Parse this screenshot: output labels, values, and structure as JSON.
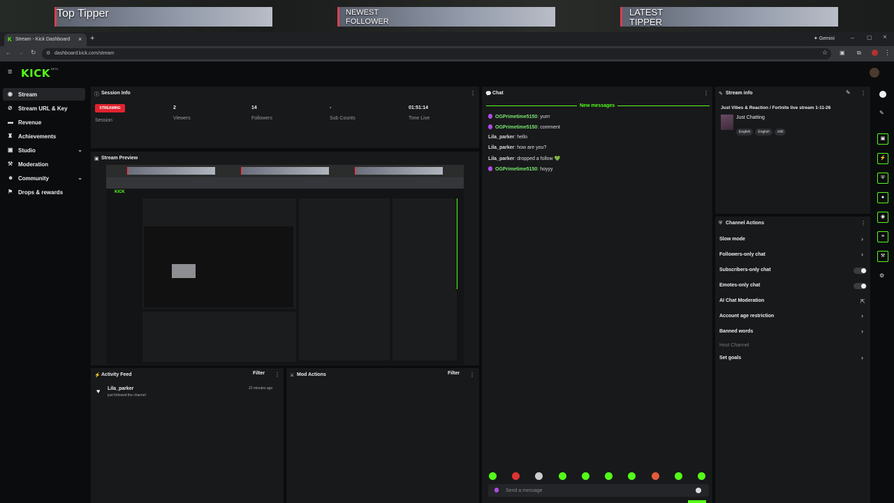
{
  "overlay": {
    "top_tipper": "Top Tipper",
    "newest_follower_l1": "NEWEST",
    "newest_follower_l2": "FOLLOWER",
    "latest_tipper_l1": "LATEST",
    "latest_tipper_l2": "TIPPER"
  },
  "browser": {
    "tab_title": "Stream - Kick Dashboard",
    "url": "dashboard.kick.com/stream",
    "gemini": "Gemini"
  },
  "app": {
    "logo": "KICK",
    "logo_tag": "BETA"
  },
  "sidebar": {
    "items": [
      {
        "label": "Stream",
        "icon": "broadcast-icon"
      },
      {
        "label": "Stream URL & Key",
        "icon": "link-icon"
      },
      {
        "label": "Revenue",
        "icon": "revenue-icon"
      },
      {
        "label": "Achievements",
        "icon": "trophy-icon"
      },
      {
        "label": "Studio",
        "icon": "studio-icon"
      },
      {
        "label": "Moderation",
        "icon": "wrench-icon"
      },
      {
        "label": "Community",
        "icon": "community-icon"
      },
      {
        "label": "Drops & rewards",
        "icon": "gift-icon"
      }
    ]
  },
  "session": {
    "title": "Session Info",
    "status": "STREAMING",
    "session_label": "Session",
    "viewers": "2",
    "viewers_label": "Viewers",
    "followers": "14",
    "followers_label": "Followers",
    "subs": "-",
    "subs_label": "Sub Counts",
    "time_live": "01:51:14",
    "time_label": "Time Live"
  },
  "preview": {
    "title": "Stream Preview"
  },
  "activity": {
    "title": "Activity Feed",
    "filter": "Filter",
    "user": "Lila_parker",
    "action": "just followed the channel",
    "time": "22 minutes ago"
  },
  "mod": {
    "title": "Mod Actions",
    "filter": "Filter"
  },
  "chat": {
    "title": "Chat",
    "new_messages": "New messages",
    "messages": [
      {
        "user": "OGPrimetime5150",
        "text": " yurrr",
        "mic": true
      },
      {
        "user": "OGPrimetime5150",
        "text": " comment",
        "mic": true
      },
      {
        "user": "Lila_parker",
        "text": " hello",
        "mic": false
      },
      {
        "user": "Lila_parker",
        "text": " how are you?",
        "mic": false
      },
      {
        "user": "Lila_parker",
        "text": " dropped a follow 💚",
        "mic": false
      },
      {
        "user": "OGPrimetime5150",
        "text": " hoyyy",
        "mic": true
      }
    ],
    "input_placeholder": "Send a message"
  },
  "stream_info": {
    "title": "Stream info",
    "stream_title": "Just Vibes & Reaction / Fortnite live stream 1-11-26",
    "category": "Just Chatting",
    "tags": [
      "English",
      "English",
      "chill"
    ]
  },
  "channel_actions": {
    "title": "Channel Actions",
    "rows": {
      "slow_mode": "Slow mode",
      "followers_only": "Followers-only chat",
      "subscribers_only": "Subscribers-only chat",
      "emotes_only": "Emotes-only chat",
      "ai_mod": "AI Chat Moderation",
      "age_restriction": "Account age restriction",
      "banned_words": "Banned words",
      "host_channel": "Host Channel",
      "set_goals": "Set goals"
    }
  },
  "colors": {
    "accent": "#53fc18",
    "live": "#e0232e",
    "panel": "#18191b"
  }
}
